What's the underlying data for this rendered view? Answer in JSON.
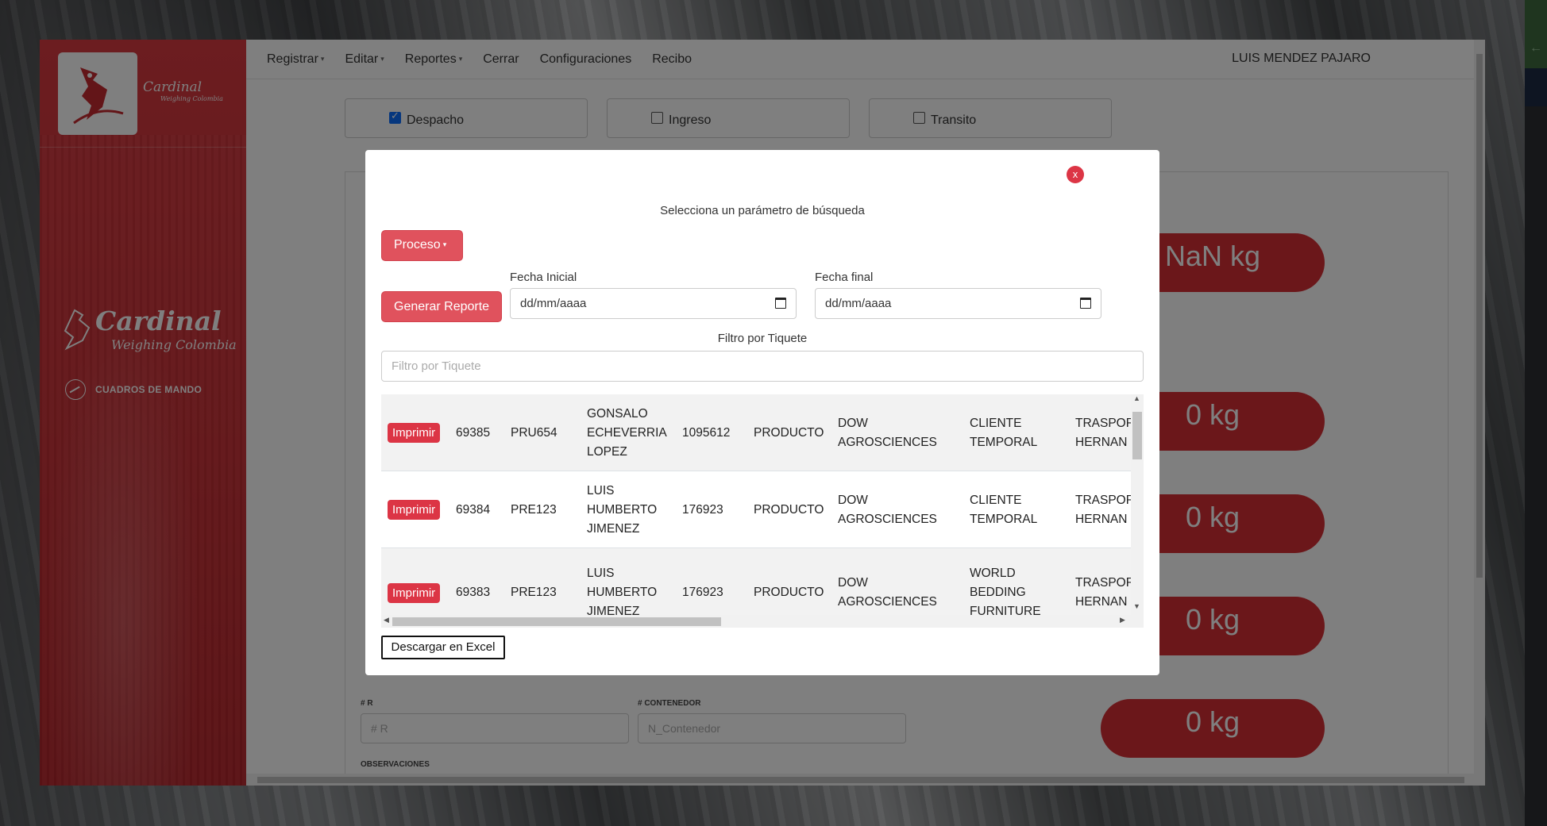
{
  "brand": {
    "name": "Cardinal",
    "subtitle": "Weighing Colombia"
  },
  "sidebar": {
    "menu_item": "CUADROS DE MANDO"
  },
  "topnav": {
    "items": [
      {
        "label": "Registrar",
        "dropdown": true
      },
      {
        "label": "Editar",
        "dropdown": true
      },
      {
        "label": "Reportes",
        "dropdown": true
      },
      {
        "label": "Cerrar",
        "dropdown": false
      },
      {
        "label": "Configuraciones",
        "dropdown": false
      },
      {
        "label": "Recibo",
        "dropdown": false
      }
    ],
    "user": "LUIS MENDEZ PAJARO"
  },
  "mode_checkboxes": [
    {
      "label": "Despacho",
      "checked": true
    },
    {
      "label": "Ingreso",
      "checked": false
    },
    {
      "label": "Transito",
      "checked": false
    }
  ],
  "background_form": {
    "label_r": "# R",
    "label_contenedor": "# CONTENEDOR",
    "placeholder_r": "# R",
    "placeholder_contenedor": "N_Contenedor",
    "label_observaciones": "OBSERVACIONES",
    "stats": [
      "NaN kg",
      "0 kg",
      "0 kg",
      "0 kg",
      "0 kg"
    ]
  },
  "modal": {
    "close_label": "x",
    "title": "Selecciona un parámetro de búsqueda",
    "proceso_button": "Proceso",
    "generar_button": "Generar Reporte",
    "fecha_inicial_label": "Fecha Inicial",
    "fecha_final_label": "Fecha final",
    "date_placeholder": "dd/mm/aaaa",
    "filter_label": "Filtro por Tiquete",
    "filter_placeholder": "Filtro por Tiquete",
    "excel_button": "Descargar en Excel",
    "rows": [
      {
        "action": "Imprimir",
        "ticket": "69385",
        "plate": "PRU654",
        "driver": "GONSALO ECHEVERRIA LOPEZ",
        "id": "1095612",
        "type": "PRODUCTO",
        "company": "DOW AGROSCIENCES",
        "client": "CLIENTE TEMPORAL",
        "transport": "TRASPOR HERNAN"
      },
      {
        "action": "Imprimir",
        "ticket": "69384",
        "plate": "PRE123",
        "driver": "LUIS HUMBERTO JIMENEZ",
        "id": "176923",
        "type": "PRODUCTO",
        "company": "DOW AGROSCIENCES",
        "client": "CLIENTE TEMPORAL",
        "transport": "TRASPOR HERNAN"
      },
      {
        "action": "Imprimir",
        "ticket": "69383",
        "plate": "PRE123",
        "driver": "LUIS HUMBERTO JIMENEZ",
        "id": "176923",
        "type": "PRODUCTO",
        "company": "DOW AGROSCIENCES",
        "client": "WORLD BEDDING FURNITURE",
        "transport": "TRASPOR HERNAN"
      }
    ]
  }
}
